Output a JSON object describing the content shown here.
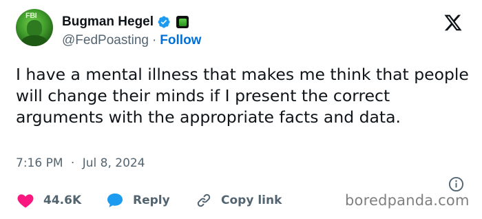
{
  "author": {
    "display_name": "Bugman Hegel",
    "handle": "@FedPoasting",
    "separator": "·",
    "follow_label": "Follow",
    "avatar_text": "FBI"
  },
  "tweet": {
    "text": "I have a mental illness that makes me think that people will change their minds if I present the correct arguments with the appropriate facts and data.",
    "time": "7:16 PM",
    "date_separator": "·",
    "date": "Jul 8, 2024"
  },
  "actions": {
    "like_count": "44.6K",
    "reply_label": "Reply",
    "copy_link_label": "Copy link"
  },
  "watermark": "boredpanda.com",
  "colors": {
    "link_blue": "#006fd6",
    "verified_blue": "#1d9bf0",
    "like_pink": "#f91880",
    "muted_gray": "#536471"
  },
  "icons": {
    "verified": "verified-badge-icon",
    "affiliate": "affiliate-badge-icon",
    "x_logo": "x-logo-icon",
    "info": "info-icon",
    "like": "heart-icon",
    "reply": "speech-bubble-icon",
    "copy_link": "link-icon"
  }
}
